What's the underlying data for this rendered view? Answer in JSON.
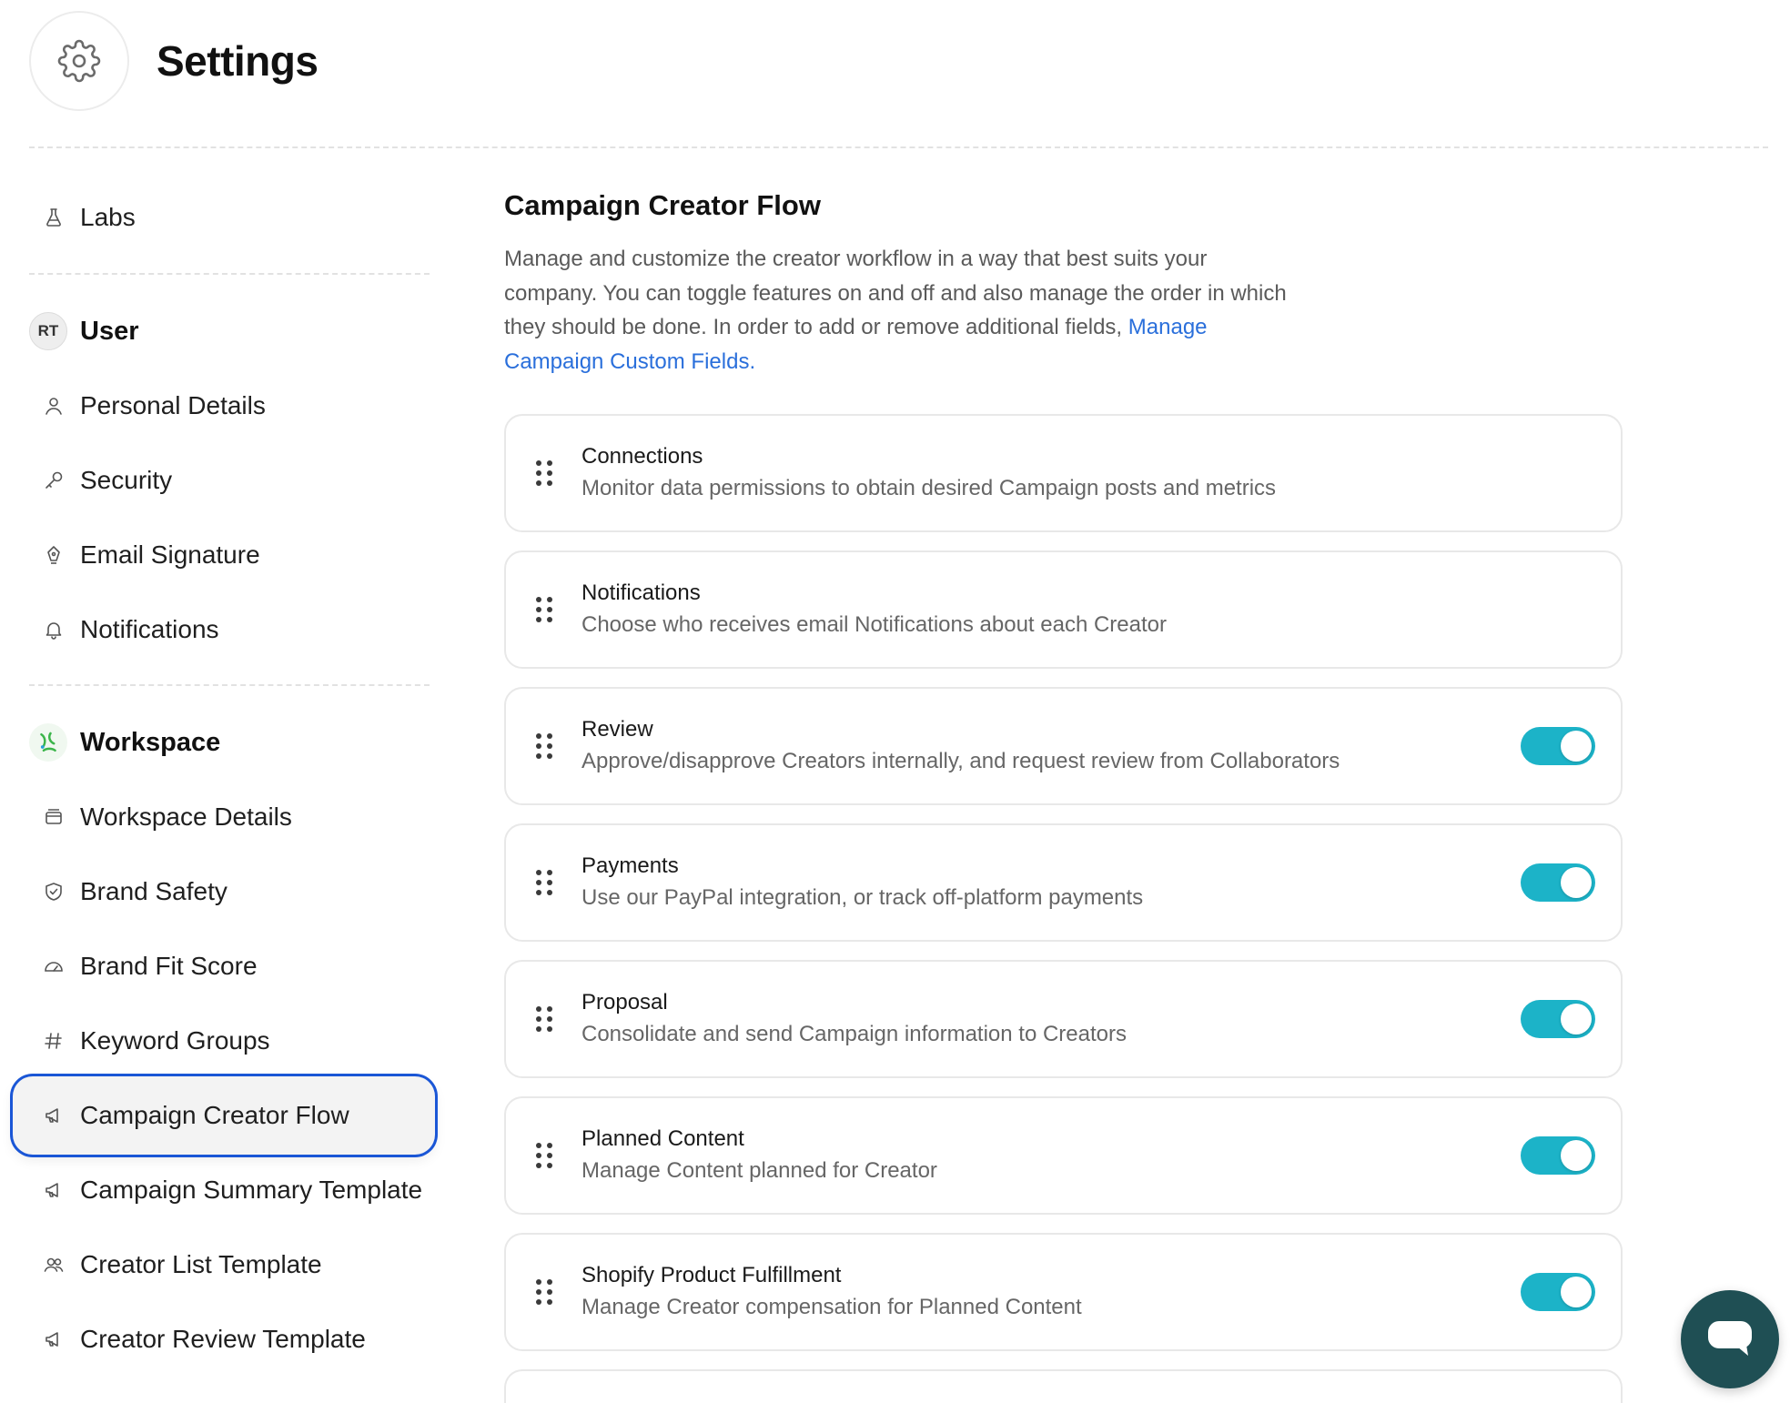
{
  "header": {
    "title": "Settings",
    "icon": "gear-icon"
  },
  "sidebar": {
    "labs": {
      "label": "Labs",
      "icon": "flask-icon"
    },
    "user_section": {
      "avatar": "RT",
      "label": "User"
    },
    "user_items": [
      {
        "label": "Personal Details",
        "icon": "person-icon"
      },
      {
        "label": "Security",
        "icon": "key-icon"
      },
      {
        "label": "Email Signature",
        "icon": "pen-nib-icon"
      },
      {
        "label": "Notifications",
        "icon": "bell-icon"
      }
    ],
    "workspace_section": {
      "label": "Workspace"
    },
    "workspace_items": [
      {
        "label": "Workspace Details",
        "icon": "window-icon"
      },
      {
        "label": "Brand Safety",
        "icon": "shield-check-icon"
      },
      {
        "label": "Brand Fit Score",
        "icon": "gauge-icon"
      },
      {
        "label": "Keyword Groups",
        "icon": "hash-icon"
      },
      {
        "label": "Campaign Creator Flow",
        "icon": "megaphone-icon",
        "active": true
      },
      {
        "label": "Campaign Summary Template",
        "icon": "megaphone-icon"
      },
      {
        "label": "Creator List Template",
        "icon": "people-icon"
      },
      {
        "label": "Creator Review Template",
        "icon": "megaphone-icon"
      }
    ]
  },
  "main": {
    "title": "Campaign Creator Flow",
    "description": "Manage and customize the creator workflow in a way that best suits your company. You can toggle features on and off and also manage the order in which they should be done. In order to add or remove additional fields,",
    "link": "Manage Campaign Custom Fields",
    "link_suffix": ".",
    "steps": [
      {
        "title": "Connections",
        "subtitle": "Monitor data permissions to obtain desired Campaign posts and metrics",
        "toggle": null
      },
      {
        "title": "Notifications",
        "subtitle": "Choose who receives email Notifications about each Creator",
        "toggle": null
      },
      {
        "title": "Review",
        "subtitle": "Approve/disapprove Creators internally, and request review from Collaborators",
        "toggle": true
      },
      {
        "title": "Payments",
        "subtitle": "Use our PayPal integration, or track off-platform payments",
        "toggle": true
      },
      {
        "title": "Proposal",
        "subtitle": "Consolidate and send Campaign information to Creators",
        "toggle": true
      },
      {
        "title": "Planned Content",
        "subtitle": "Manage Content planned for Creator",
        "toggle": true
      },
      {
        "title": "Shopify Product Fulfillment",
        "subtitle": "Manage Creator compensation for Planned Content",
        "toggle": true
      }
    ]
  },
  "colors": {
    "accent": "#1cb3c8",
    "link": "#2a6fdb",
    "active_outline": "#1a56d6",
    "chat": "#1f4f54"
  }
}
